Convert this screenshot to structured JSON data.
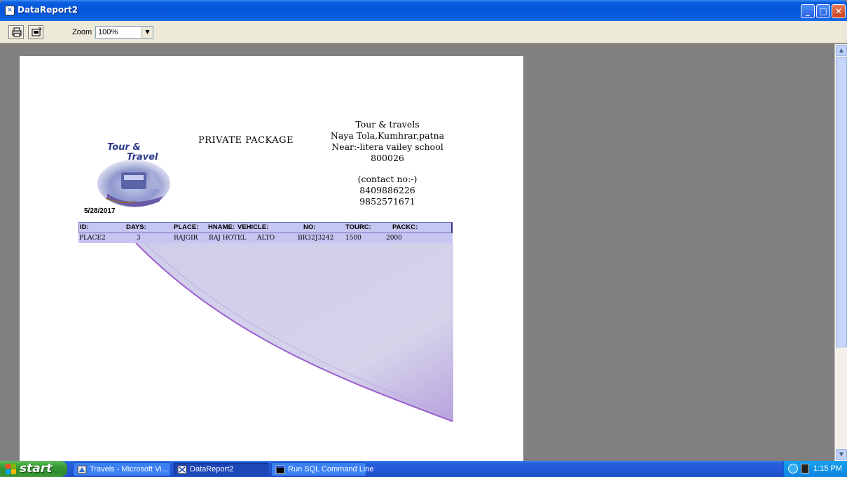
{
  "window": {
    "title": "DataReport2"
  },
  "toolbar": {
    "zoom_label": "Zoom",
    "zoom_value": "100%"
  },
  "report": {
    "logo_text_top": "Tour &",
    "logo_text_bottom": "Travel",
    "title": "PRIVATE PACKAGE",
    "company_lines": [
      "Tour & travels",
      "Naya Tola,Kumhrar,patna",
      "Near:-litera vailey school",
      "800026"
    ],
    "contact_lines": [
      "(contact no:-)",
      "8409886226",
      "9852571671"
    ],
    "date": "5/28/2017",
    "columns": [
      "ID:",
      "DAYS:",
      "PLACE:",
      "HNAME:",
      "VEHICLE:",
      "NO:",
      "TOURC:",
      "PACKC:"
    ],
    "rows": [
      [
        "PLACE2",
        "3",
        "RAJGIR",
        "RAJ HOTEL",
        "ALTO",
        "BR32J3242",
        "1500",
        "2000"
      ]
    ]
  },
  "taskbar": {
    "start_label": "start",
    "tasks": [
      {
        "label": "Travels - Microsoft Vi..."
      },
      {
        "label": "DataReport2"
      },
      {
        "label": "Run SQL Command Line"
      }
    ],
    "clock": "1:15 PM"
  }
}
